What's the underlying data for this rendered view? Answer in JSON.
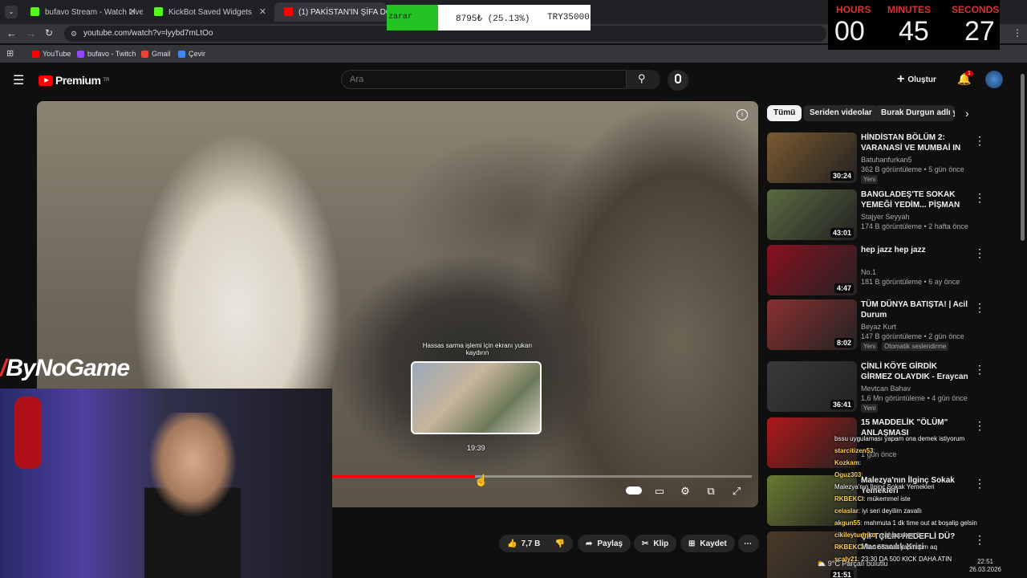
{
  "browser": {
    "tabs": [
      {
        "label": "bufavo Stream - Watch Live on",
        "color": "#53fc18"
      },
      {
        "label": "KickBot Saved Widgets",
        "color": "#53fc18"
      },
      {
        "label": "(1) PAKİSTAN'IN ŞİFA DOLU SO",
        "color": "#ff0000"
      }
    ],
    "url": "youtube.com/watch?v=lyybd7mLtOo",
    "bookmarks": [
      "YouTube",
      "bufavo - Twitch",
      "Gmail",
      "Çevir"
    ]
  },
  "overlay": {
    "zarar_label": "zarar",
    "zarar_amount": "8795₺ (25.13%)",
    "zarar_target": "TRY35000",
    "timer": {
      "hours_label": "HOURS",
      "minutes_label": "MINUTES",
      "seconds_label": "SECONDS",
      "hours": "00",
      "minutes": "45",
      "seconds": "27"
    },
    "streamer_logo": "ByNoGame"
  },
  "youtube": {
    "logo": "Premium",
    "logo_sup": "TR",
    "search_placeholder": "Ara",
    "create_label": "Oluştur",
    "notif_count": "1",
    "video": {
      "preview_hint": "Hassas sarma işlemi için ekranı yukarı kaydırın",
      "preview_time": "19:39",
      "progress": 0.34
    },
    "actions": {
      "likes": "7,7 B",
      "share": "Paylaş",
      "clip": "Klip",
      "save": "Kaydet"
    },
    "chips": [
      "Tümü",
      "Seriden videolar",
      "Burak Durgun adlı yü"
    ],
    "recommendations": [
      {
        "title": "HİNDİSTAN BÖLÜM 2: VARANASİ VE MUMBAİ IN",
        "channel": "Batuhanfurkan5",
        "meta": "362 B görüntüleme • 5 gün önce",
        "badge": "Yeni",
        "duration": "30:24",
        "thumb": "#7a5a30"
      },
      {
        "title": "BANGLADEŞ'TE SOKAK YEMEĞİ YEDİM... PİŞMAN OLDUM! ...",
        "channel": "Stajyer Seyyah",
        "meta": "174 B görüntüleme • 2 hafta önce",
        "badge": "",
        "duration": "43:01",
        "thumb": "#5a6a40"
      },
      {
        "title": "hep jazz hep jazz",
        "channel": "No.1",
        "meta": "181 B görüntüleme • 6 ay önce",
        "badge": "",
        "duration": "4:47",
        "thumb": "#8a1020"
      },
      {
        "title": "TÜM DÜNYA BATIŞTA! | Acil Durum",
        "channel": "Beyaz Kurt",
        "meta": "147 B görüntüleme • 2 gün önce",
        "badge": "Yeni",
        "badge2": "Otomatik seslendirme",
        "duration": "8:02",
        "thumb": "#8a3030"
      },
      {
        "title": "ÇİNLİ KÖYE GİRDİK GİRMEZ OLAYDIK - Eraycan zıpladı",
        "channel": "Mevtcan Bahav",
        "meta": "1,6 Mn görüntüleme • 4 gün önce",
        "badge": "Yeni",
        "duration": "36:41",
        "thumb": "#3a3a3a"
      },
      {
        "title": "15 MADDELİK \"ÖLÜM\" ANLAŞMASI",
        "channel": "",
        "meta": "1 gün önce",
        "badge": "",
        "duration": "",
        "thumb": "#b01818"
      },
      {
        "title": "Malezya'nın İlginç Sokak Yemekleri",
        "channel": "",
        "meta": "",
        "badge": "",
        "duration": "",
        "thumb": "#6a7a30"
      },
      {
        "title": "ÇİFTÇİLİK HEDEFLİ DÜ? Maceracılık Krizi",
        "channel": "",
        "meta": "",
        "badge": "",
        "duration": "21:51",
        "thumb": "#4a3a2a"
      }
    ]
  },
  "chat": [
    {
      "user": "",
      "text": "bssu uygulaması yapam ona demek istiyorum"
    },
    {
      "user": "starcitizen53",
      "text": ":"
    },
    {
      "user": "Kozkam:",
      "text": ""
    },
    {
      "user": "Oguz303",
      "text": ":"
    },
    {
      "user": "",
      "text": "Malezya'nın İlginç Sokak Yemekleri"
    },
    {
      "user": "RKBEKCI",
      "text": ": mükemmel iste"
    },
    {
      "user": "celaslar",
      "text": ": iyi seri deyilim zavallı"
    },
    {
      "user": "akgun55",
      "text": ": mahmuta 1 dk time out at boşalip gelsin"
    },
    {
      "user": "cikileyturinko",
      "text": ": mahsup hee ö"
    },
    {
      "user": "RKBEKCI",
      "text": ": lan 68 saat yapmışım aq"
    },
    {
      "user": "scaly21",
      "text": ": 23:30 DA 500 KICK DAHA ATIN"
    }
  ],
  "system": {
    "weather": "9°C Parçalı bulutlu",
    "time": "22:51",
    "date": "26.03.2026"
  }
}
